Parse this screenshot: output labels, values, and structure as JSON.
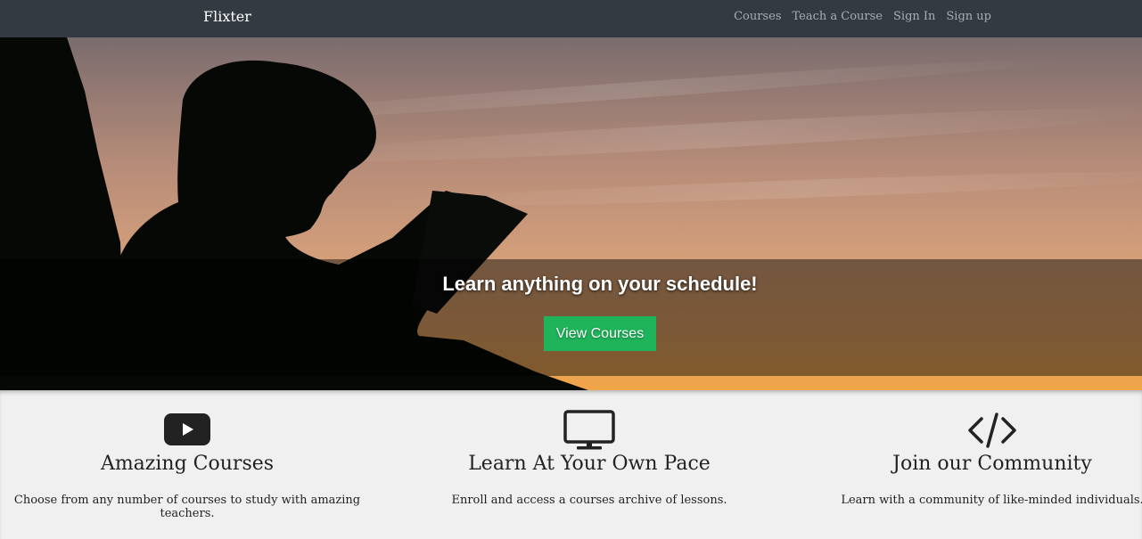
{
  "nav": {
    "brand": "Flixter",
    "links": [
      "Courses",
      "Teach a Course",
      "Sign In",
      "Sign up"
    ]
  },
  "hero": {
    "title": "Learn anything on your schedule!",
    "button": "View Courses",
    "image": "silhouette-reading-sunset",
    "button_color": "#1fb35a"
  },
  "features": [
    {
      "icon": "youtube-play-icon",
      "title": "Amazing Courses",
      "text": "Choose from any number of courses to study with amazing teachers."
    },
    {
      "icon": "monitor-icon",
      "title": "Learn At Your Own Pace",
      "text": "Enroll and access a courses archive of lessons."
    },
    {
      "icon": "code-icon",
      "title": "Join our Community",
      "text": "Learn with a community of like-minded individuals."
    }
  ],
  "colors": {
    "navbar": "#343a42",
    "background": "#f0f0f0"
  }
}
